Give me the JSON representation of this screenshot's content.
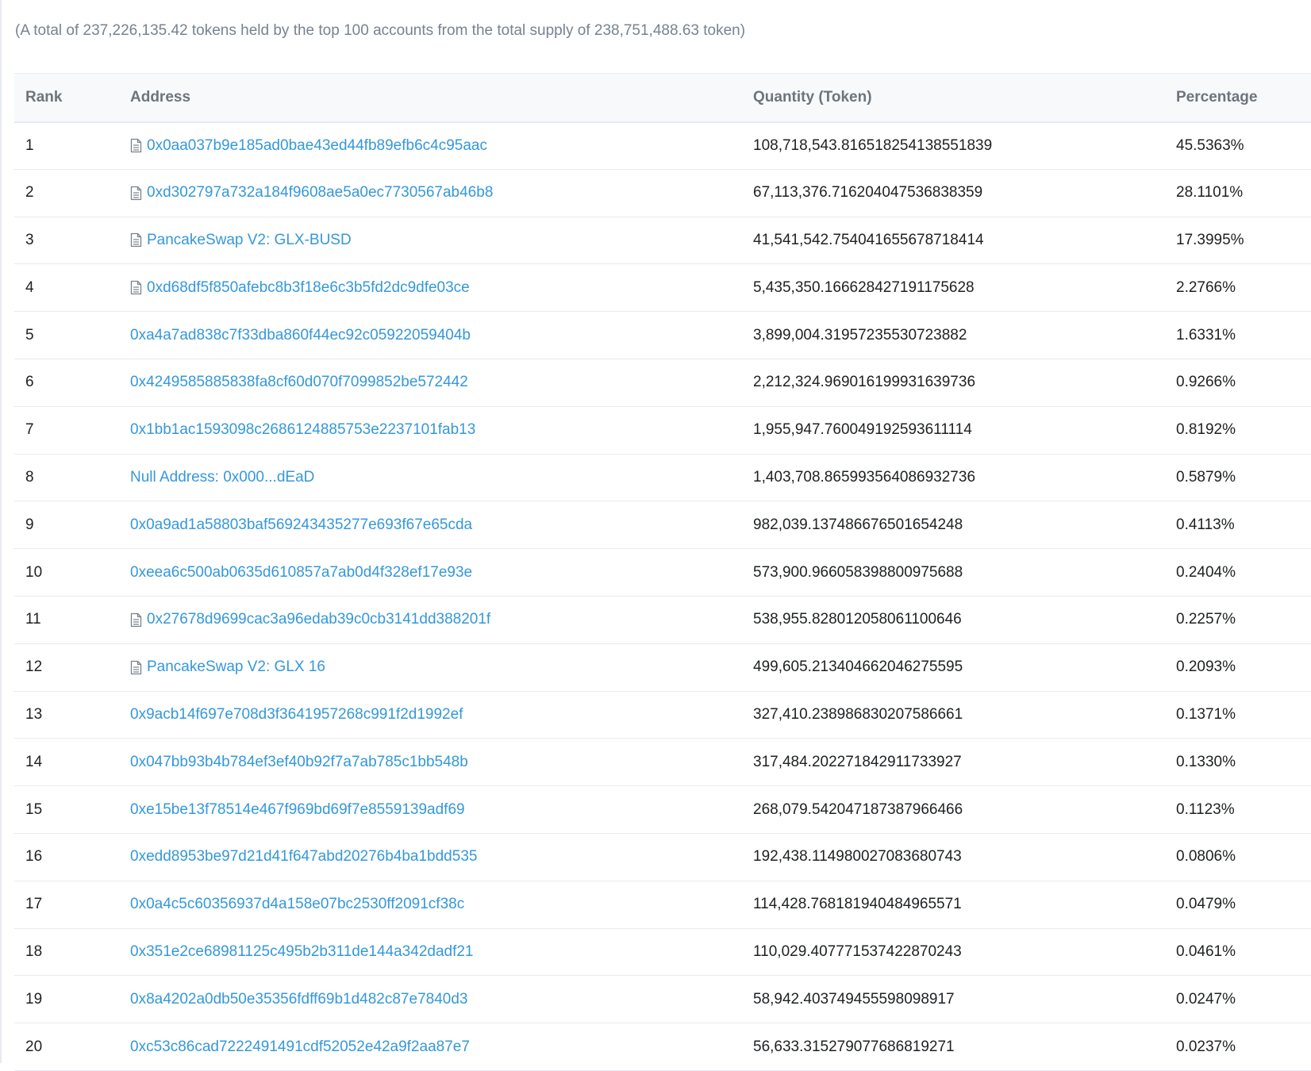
{
  "summary": "(A total of 237,226,135.42 tokens held by the top 100 accounts from the total supply of 238,751,488.63 token)",
  "table": {
    "headers": {
      "rank": "Rank",
      "address": "Address",
      "quantity": "Quantity (Token)",
      "percentage": "Percentage"
    },
    "rows": [
      {
        "rank": "1",
        "address": "0x0aa037b9e185ad0bae43ed44fb89efb6c4c95aac",
        "contract": true,
        "quantity": "108,718,543.816518254138551839",
        "percentage": "45.5363%"
      },
      {
        "rank": "2",
        "address": "0xd302797a732a184f9608ae5a0ec7730567ab46b8",
        "contract": true,
        "quantity": "67,113,376.716204047536838359",
        "percentage": "28.1101%"
      },
      {
        "rank": "3",
        "address": "PancakeSwap V2: GLX-BUSD",
        "contract": true,
        "quantity": "41,541,542.754041655678718414",
        "percentage": "17.3995%"
      },
      {
        "rank": "4",
        "address": "0xd68df5f850afebc8b3f18e6c3b5fd2dc9dfe03ce",
        "contract": true,
        "quantity": "5,435,350.166628427191175628",
        "percentage": "2.2766%"
      },
      {
        "rank": "5",
        "address": "0xa4a7ad838c7f33dba860f44ec92c05922059404b",
        "contract": false,
        "quantity": "3,899,004.31957235530723882",
        "percentage": "1.6331%"
      },
      {
        "rank": "6",
        "address": "0x4249585885838fa8cf60d070f7099852be572442",
        "contract": false,
        "quantity": "2,212,324.969016199931639736",
        "percentage": "0.9266%"
      },
      {
        "rank": "7",
        "address": "0x1bb1ac1593098c2686124885753e2237101fab13",
        "contract": false,
        "quantity": "1,955,947.760049192593611114",
        "percentage": "0.8192%"
      },
      {
        "rank": "8",
        "address": "Null Address: 0x000...dEaD",
        "contract": false,
        "quantity": "1,403,708.865993564086932736",
        "percentage": "0.5879%"
      },
      {
        "rank": "9",
        "address": "0x0a9ad1a58803baf569243435277e693f67e65cda",
        "contract": false,
        "quantity": "982,039.137486676501654248",
        "percentage": "0.4113%"
      },
      {
        "rank": "10",
        "address": "0xeea6c500ab0635d610857a7ab0d4f328ef17e93e",
        "contract": false,
        "quantity": "573,900.966058398800975688",
        "percentage": "0.2404%"
      },
      {
        "rank": "11",
        "address": "0x27678d9699cac3a96edab39c0cb3141dd388201f",
        "contract": true,
        "quantity": "538,955.828012058061100646",
        "percentage": "0.2257%"
      },
      {
        "rank": "12",
        "address": "PancakeSwap V2: GLX 16",
        "contract": true,
        "quantity": "499,605.213404662046275595",
        "percentage": "0.2093%"
      },
      {
        "rank": "13",
        "address": "0x9acb14f697e708d3f3641957268c991f2d1992ef",
        "contract": false,
        "quantity": "327,410.238986830207586661",
        "percentage": "0.1371%"
      },
      {
        "rank": "14",
        "address": "0x047bb93b4b784ef3ef40b92f7a7ab785c1bb548b",
        "contract": false,
        "quantity": "317,484.202271842911733927",
        "percentage": "0.1330%"
      },
      {
        "rank": "15",
        "address": "0xe15be13f78514e467f969bd69f7e8559139adf69",
        "contract": false,
        "quantity": "268,079.542047187387966466",
        "percentage": "0.1123%"
      },
      {
        "rank": "16",
        "address": "0xedd8953be97d21d41f647abd20276b4ba1bdd535",
        "contract": false,
        "quantity": "192,438.114980027083680743",
        "percentage": "0.0806%"
      },
      {
        "rank": "17",
        "address": "0x0a4c5c60356937d4a158e07bc2530ff2091cf38c",
        "contract": false,
        "quantity": "114,428.768181940484965571",
        "percentage": "0.0479%"
      },
      {
        "rank": "18",
        "address": "0x351e2ce68981125c495b2b311de144a342dadf21",
        "contract": false,
        "quantity": "110,029.407771537422870243",
        "percentage": "0.0461%"
      },
      {
        "rank": "19",
        "address": "0x8a4202a0db50e35356fdff69b1d482c87e7840d3",
        "contract": false,
        "quantity": "58,942.403749455598098917",
        "percentage": "0.0247%"
      },
      {
        "rank": "20",
        "address": "0xc53c86cad7222491491cdf52052e42a9f2aa87e7",
        "contract": false,
        "quantity": "56,633.315279077686819271",
        "percentage": "0.0237%"
      }
    ]
  },
  "icons": {
    "contract": "contract-document-icon"
  },
  "colors": {
    "link": "#3498db",
    "muted_text": "#77838f",
    "header_text": "#6c757d",
    "header_bg": "#f8f9fa",
    "border": "#e7eaf3"
  }
}
